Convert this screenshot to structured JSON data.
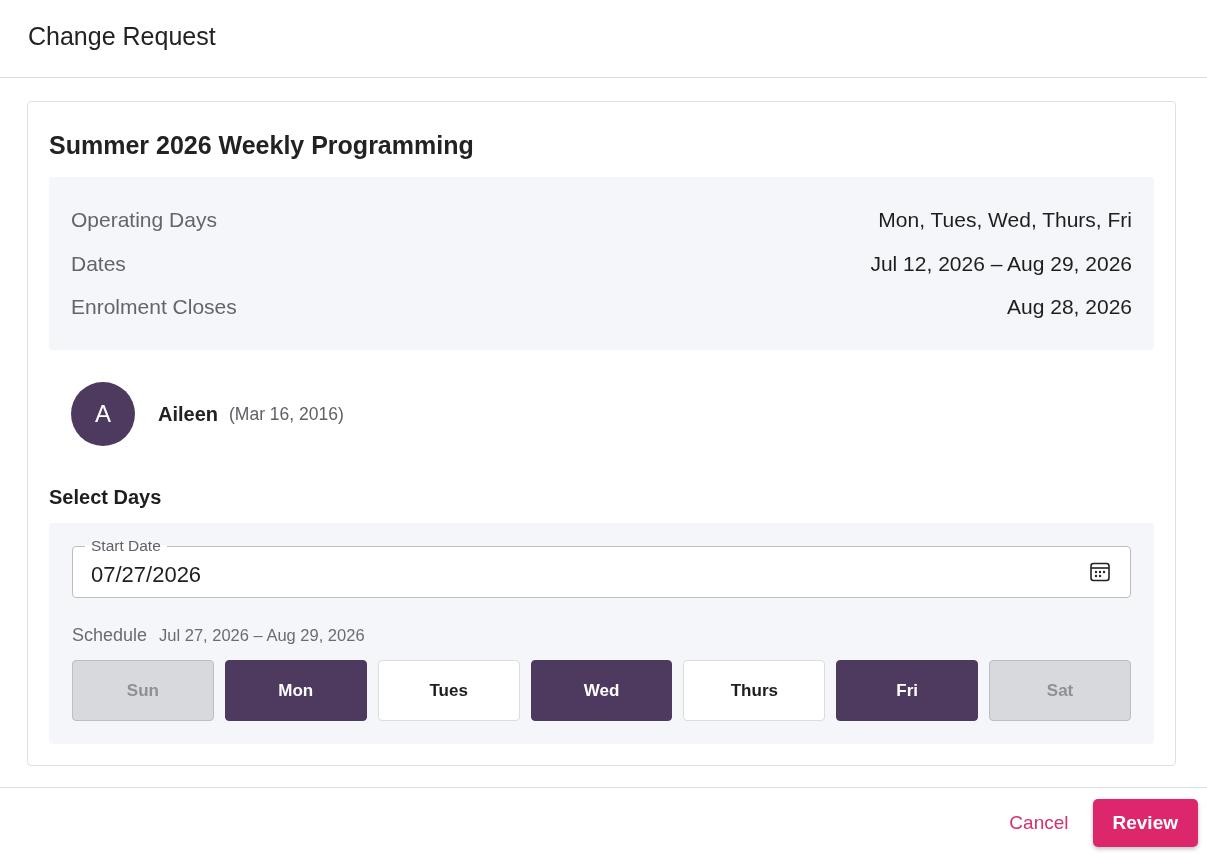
{
  "header": {
    "title": "Change Request"
  },
  "program": {
    "title": "Summer 2026 Weekly Programming",
    "details": [
      {
        "label": "Operating Days",
        "value": "Mon, Tues, Wed, Thurs, Fri"
      },
      {
        "label": "Dates",
        "value": "Jul 12, 2026 – Aug 29, 2026"
      },
      {
        "label": "Enrolment Closes",
        "value": "Aug 28, 2026"
      }
    ]
  },
  "child": {
    "initial": "A",
    "name": "Aileen",
    "birthdate": "(Mar 16, 2016)"
  },
  "select_days": {
    "heading": "Select Days",
    "start_date": {
      "label": "Start Date",
      "value": "07/27/2026"
    },
    "schedule": {
      "label": "Schedule",
      "range": "Jul 27, 2026 – Aug 29, 2026"
    },
    "days": [
      {
        "label": "Sun",
        "selected": false,
        "disabled": true
      },
      {
        "label": "Mon",
        "selected": true,
        "disabled": false
      },
      {
        "label": "Tues",
        "selected": false,
        "disabled": false
      },
      {
        "label": "Wed",
        "selected": true,
        "disabled": false
      },
      {
        "label": "Thurs",
        "selected": false,
        "disabled": false
      },
      {
        "label": "Fri",
        "selected": true,
        "disabled": false
      },
      {
        "label": "Sat",
        "selected": false,
        "disabled": true
      }
    ]
  },
  "footer": {
    "buttons": [
      {
        "label": "Cancel",
        "kind": "text"
      },
      {
        "label": "Review",
        "kind": "primary"
      }
    ]
  }
}
